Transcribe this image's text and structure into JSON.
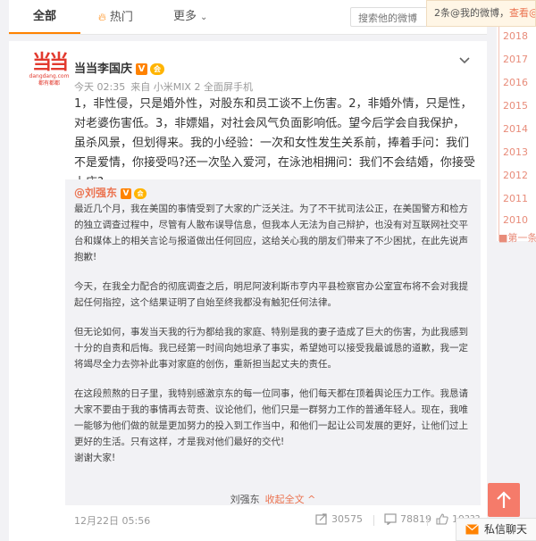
{
  "tabs": {
    "all": "全部",
    "hot": "热门",
    "more": "更多"
  },
  "search": {
    "placeholder": "搜索他的微博"
  },
  "notice": {
    "text": "2条@我的微博，",
    "link": "查看@"
  },
  "timeline": {
    "years": [
      "2018",
      "2017",
      "2016",
      "2015",
      "2014",
      "2013",
      "2012",
      "2011",
      "2010"
    ],
    "first": "第一条微"
  },
  "post": {
    "author": "当当李国庆",
    "verified_badge": "V",
    "vip_badge": "会",
    "logo_text": "当当",
    "logo_sub1": "dangdang.com",
    "logo_sub2": "都有都都",
    "time": "今天 02:35",
    "source": "来自 小米MIX 2 全面屏手机",
    "text": "1，非性侵，只是婚外性，对股东和员工谈不上伤害。2，非婚外情，只是性，对老婆伤害低。3，非嫖娼，对社会风气负面影响低。望今后学会自我保护，虽杀风景，但划得来。我的小经验：一次和女性发生关系前，捧着手问：我们不是爱情，你接受吗?还一次坠入爱河，在泳池相拥问：我们不会结婚，你接受上床?"
  },
  "repost": {
    "author": "@刘强东",
    "verified_badge": "V",
    "vip_badge": "会",
    "paragraphs": [
      "最近几个月，我在美国的事情受到了大家的广泛关注。为了不干扰司法公正，在美国警方和检方的独立调查过程中，尽管有人散布误导信息，但我本人无法为自己辩护，也没有对互联网社交平台和媒体上的相关言论与报道做出任何回应，这给关心我的朋友们带来了不少困扰，在此先说声抱歉!",
      "今天，在我全力配合的彻底调查之后，明尼阿波利斯市亨内平县检察官办公室宣布将不会对我提起任何指控，这个结果证明了自始至终我都没有触犯任何法律。",
      "但无论如何，事发当天我的行为都给我的家庭、特别是我的妻子造成了巨大的伤害，为此我感到十分的自责和后悔。我已经第一时间向她坦承了事实，希望她可以接受我最诚恳的道歉，我一定将竭尽全力去弥补此事对家庭的创伤，重新担当起丈夫的责任。",
      "在这段煎熬的日子里，我特别感激京东的每一位同事，他们每天都在顶着舆论压力工作。我恳请大家不要由于我的事情再去苛责、议论他们，他们只是一群努力工作的普通年轻人。现在，我唯一能够为他们做的就是更加努力的投入到工作当中，和他们一起让公司发展的更好，让他们过上更好的生活。只有这样，才是我对他们最好的交代!",
      "谢谢大家!"
    ],
    "footer_name": "刘强东",
    "collapse": "收起全文 ^"
  },
  "footer": {
    "date": "12月22日 05:56",
    "shares": "30575",
    "comments": "78819",
    "likes": "19???"
  },
  "private_message": "私信聊天",
  "colors": {
    "accent": "#ff8200",
    "link": "#eb7350",
    "timeline": "#e88c7a",
    "to_top": "#f57b6a"
  },
  "icons": {
    "hot": "flame-icon",
    "search": "search-icon",
    "caret": "chevron-down-icon",
    "share": "share-icon",
    "comment": "comment-icon",
    "like": "thumbs-up-icon",
    "to_top": "arrow-up-icon",
    "mail": "mail-icon"
  }
}
